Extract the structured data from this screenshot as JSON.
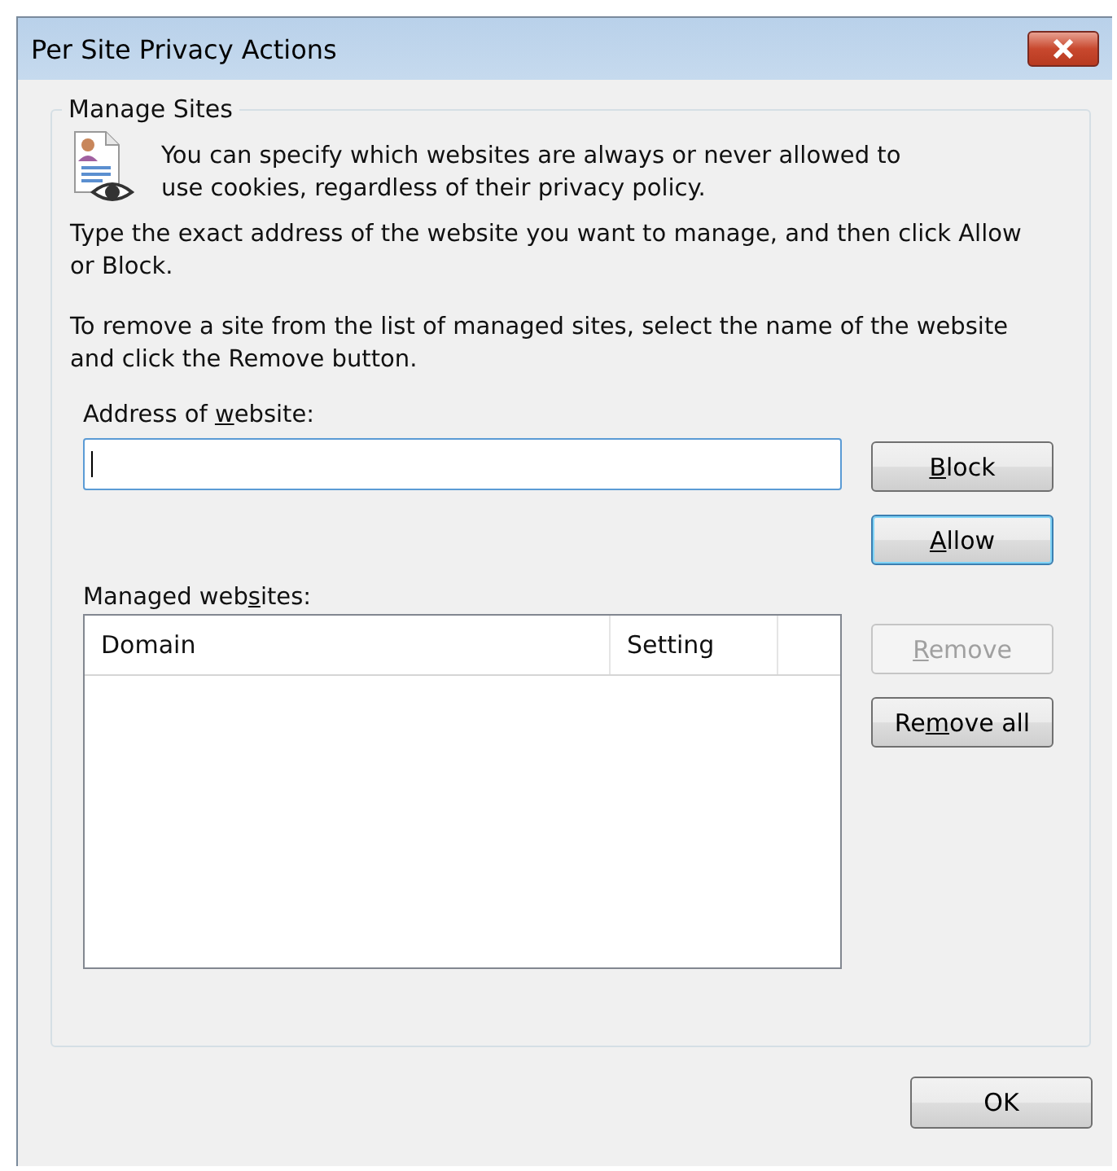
{
  "window": {
    "title": "Per Site Privacy Actions"
  },
  "group": {
    "title": "Manage Sites",
    "intro": "You can specify which websites are always or never allowed to use cookies, regardless of their privacy policy.",
    "paragraphs": [
      "Type the exact address of the website you want to manage, and then click Allow or Block.",
      "To remove a site from the list of managed sites, select the name of the website and click the Remove button."
    ],
    "address_label": {
      "pre": "Address of ",
      "key": "w",
      "post": "ebsite:"
    },
    "address_field": {
      "focused": true
    },
    "address_buttons": [
      {
        "key": "B",
        "post": "lock",
        "disabled": false,
        "default": false
      },
      {
        "key": "A",
        "post": "llow",
        "disabled": false,
        "default": true
      }
    ],
    "list_label": {
      "pre": "Managed web",
      "key": "s",
      "post": "ites:"
    },
    "list_columns": [
      "Domain",
      "Setting"
    ],
    "list_buttons": [
      {
        "key": "R",
        "post": "emove",
        "disabled": true,
        "default": false
      },
      {
        "pre": "Re",
        "key": "m",
        "post": "ove all",
        "disabled": false,
        "default": false
      }
    ]
  },
  "buttons": [
    {
      "label": "OK"
    }
  ]
}
